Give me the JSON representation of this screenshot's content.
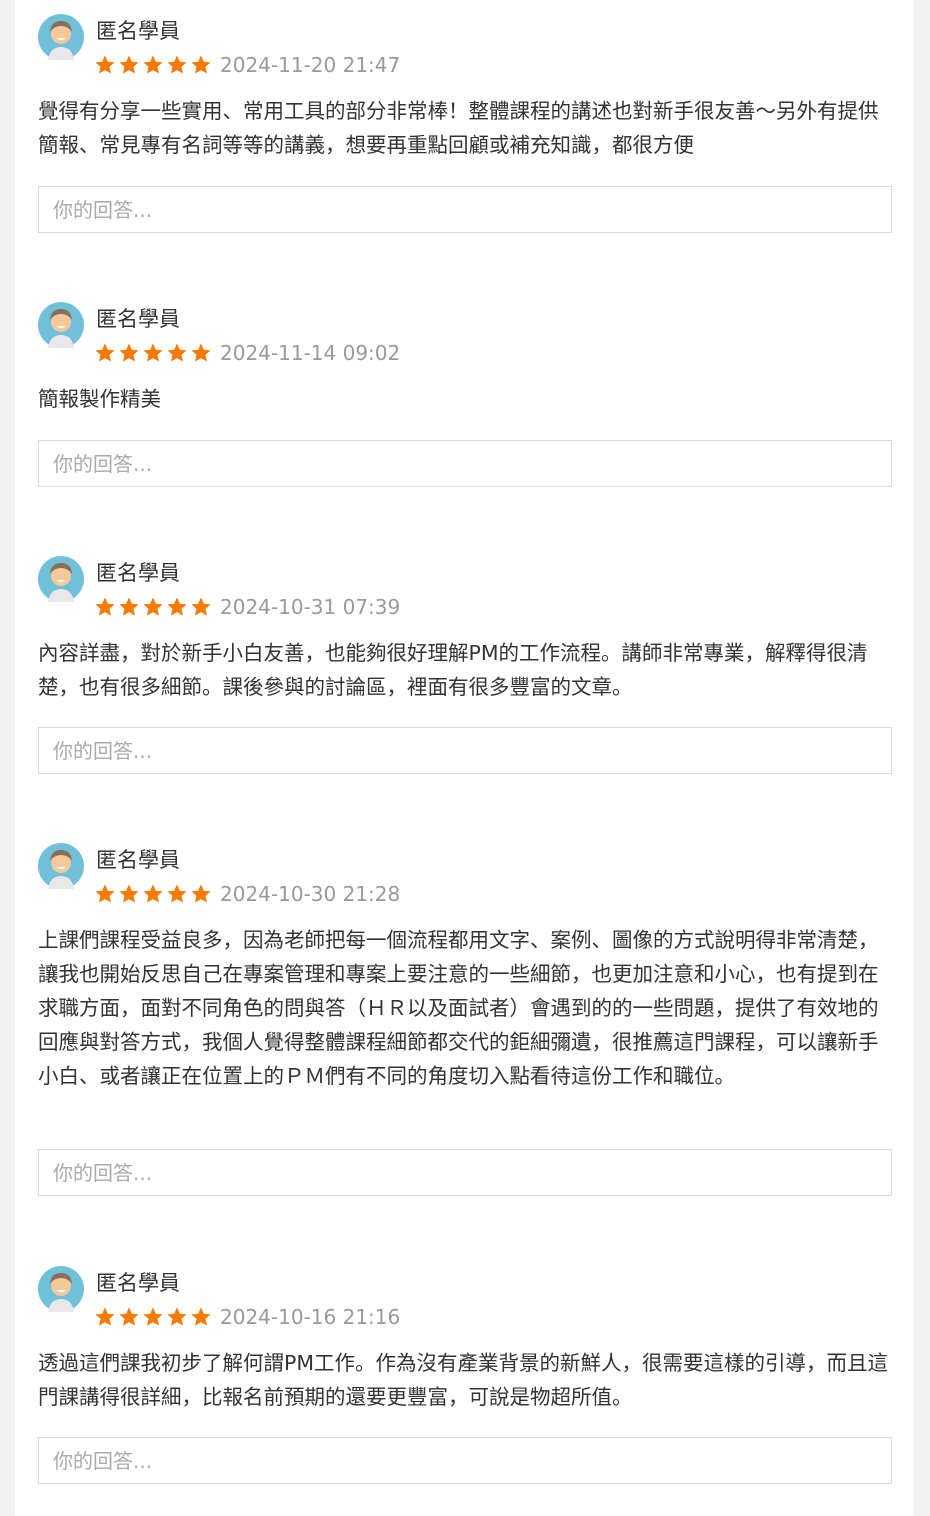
{
  "reply_placeholder": "你的回答...",
  "colors": {
    "star": "#f57c00",
    "avatar_bg": "#6fc0d8"
  },
  "reviews": [
    {
      "author": "匿名學員",
      "rating": 5,
      "date": "2024-11-20 21:47",
      "comment": "覺得有分享一些實用、常用工具的部分非常棒！整體課程的講述也對新手很友善～另外有提供簡報、常見專有名詞等等的講義，想要再重點回顧或補充知識，都很方便"
    },
    {
      "author": "匿名學員",
      "rating": 5,
      "date": "2024-11-14 09:02",
      "comment": "簡報製作精美"
    },
    {
      "author": "匿名學員",
      "rating": 5,
      "date": "2024-10-31 07:39",
      "comment": "內容詳盡，對於新手小白友善，也能夠很好理解PM的工作流程。講師非常專業，解釋得很清楚，也有很多細節。課後參與的討論區，裡面有很多豐富的文章。"
    },
    {
      "author": "匿名學員",
      "rating": 5,
      "date": "2024-10-30 21:28",
      "comment": "上課們課程受益良多，因為老師把每一個流程都用文字、案例、圖像的方式說明得非常清楚，讓我也開始反思自己在專案管理和專案上要注意的一些細節，也更加注意和小心，也有提到在求職方面，面對不同角色的問與答（ＨＲ以及面試者）會遇到的的一些問題，提供了有效地的回應與對答方式，我個人覺得整體課程細節都交代的鉅細彌遺，很推薦這門課程，可以讓新手小白、或者讓正在位置上的ＰＭ們有不同的角度切入點看待這份工作和職位。"
    },
    {
      "author": "匿名學員",
      "rating": 5,
      "date": "2024-10-16 21:16",
      "comment": "透過這們課我初步了解何謂PM工作。作為沒有產業背景的新鮮人，很需要這樣的引導，而且這門課講得很詳細，比報名前預期的還要更豐富，可說是物超所值。"
    }
  ]
}
